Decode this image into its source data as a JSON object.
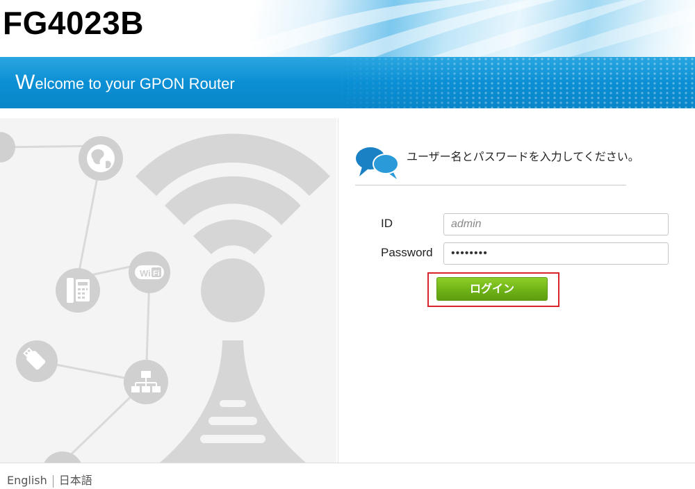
{
  "header": {
    "model_name": "FG4023B"
  },
  "banner": {
    "welcome_first_letter": "W",
    "welcome_rest": "elcome to your GPON Router"
  },
  "login": {
    "instruction": "ユーザー名とパスワードを入力してください。",
    "id_label": "ID",
    "id_placeholder": "admin",
    "password_label": "Password",
    "password_value": "••••••••",
    "login_button": "ログイン"
  },
  "footer": {
    "lang_english": "English",
    "lang_japanese": "日本語"
  },
  "colors": {
    "banner_blue": "#0b8fd4",
    "login_green": "#6eb316",
    "highlight_red": "#d9232a"
  },
  "icons": {
    "chat": "chat-bubbles-icon",
    "globe": "globe-icon",
    "phone": "phone-icon",
    "wifi": "wifi-icon",
    "usb": "usb-icon",
    "network": "network-icon",
    "signal": "signal-tower-icon"
  }
}
